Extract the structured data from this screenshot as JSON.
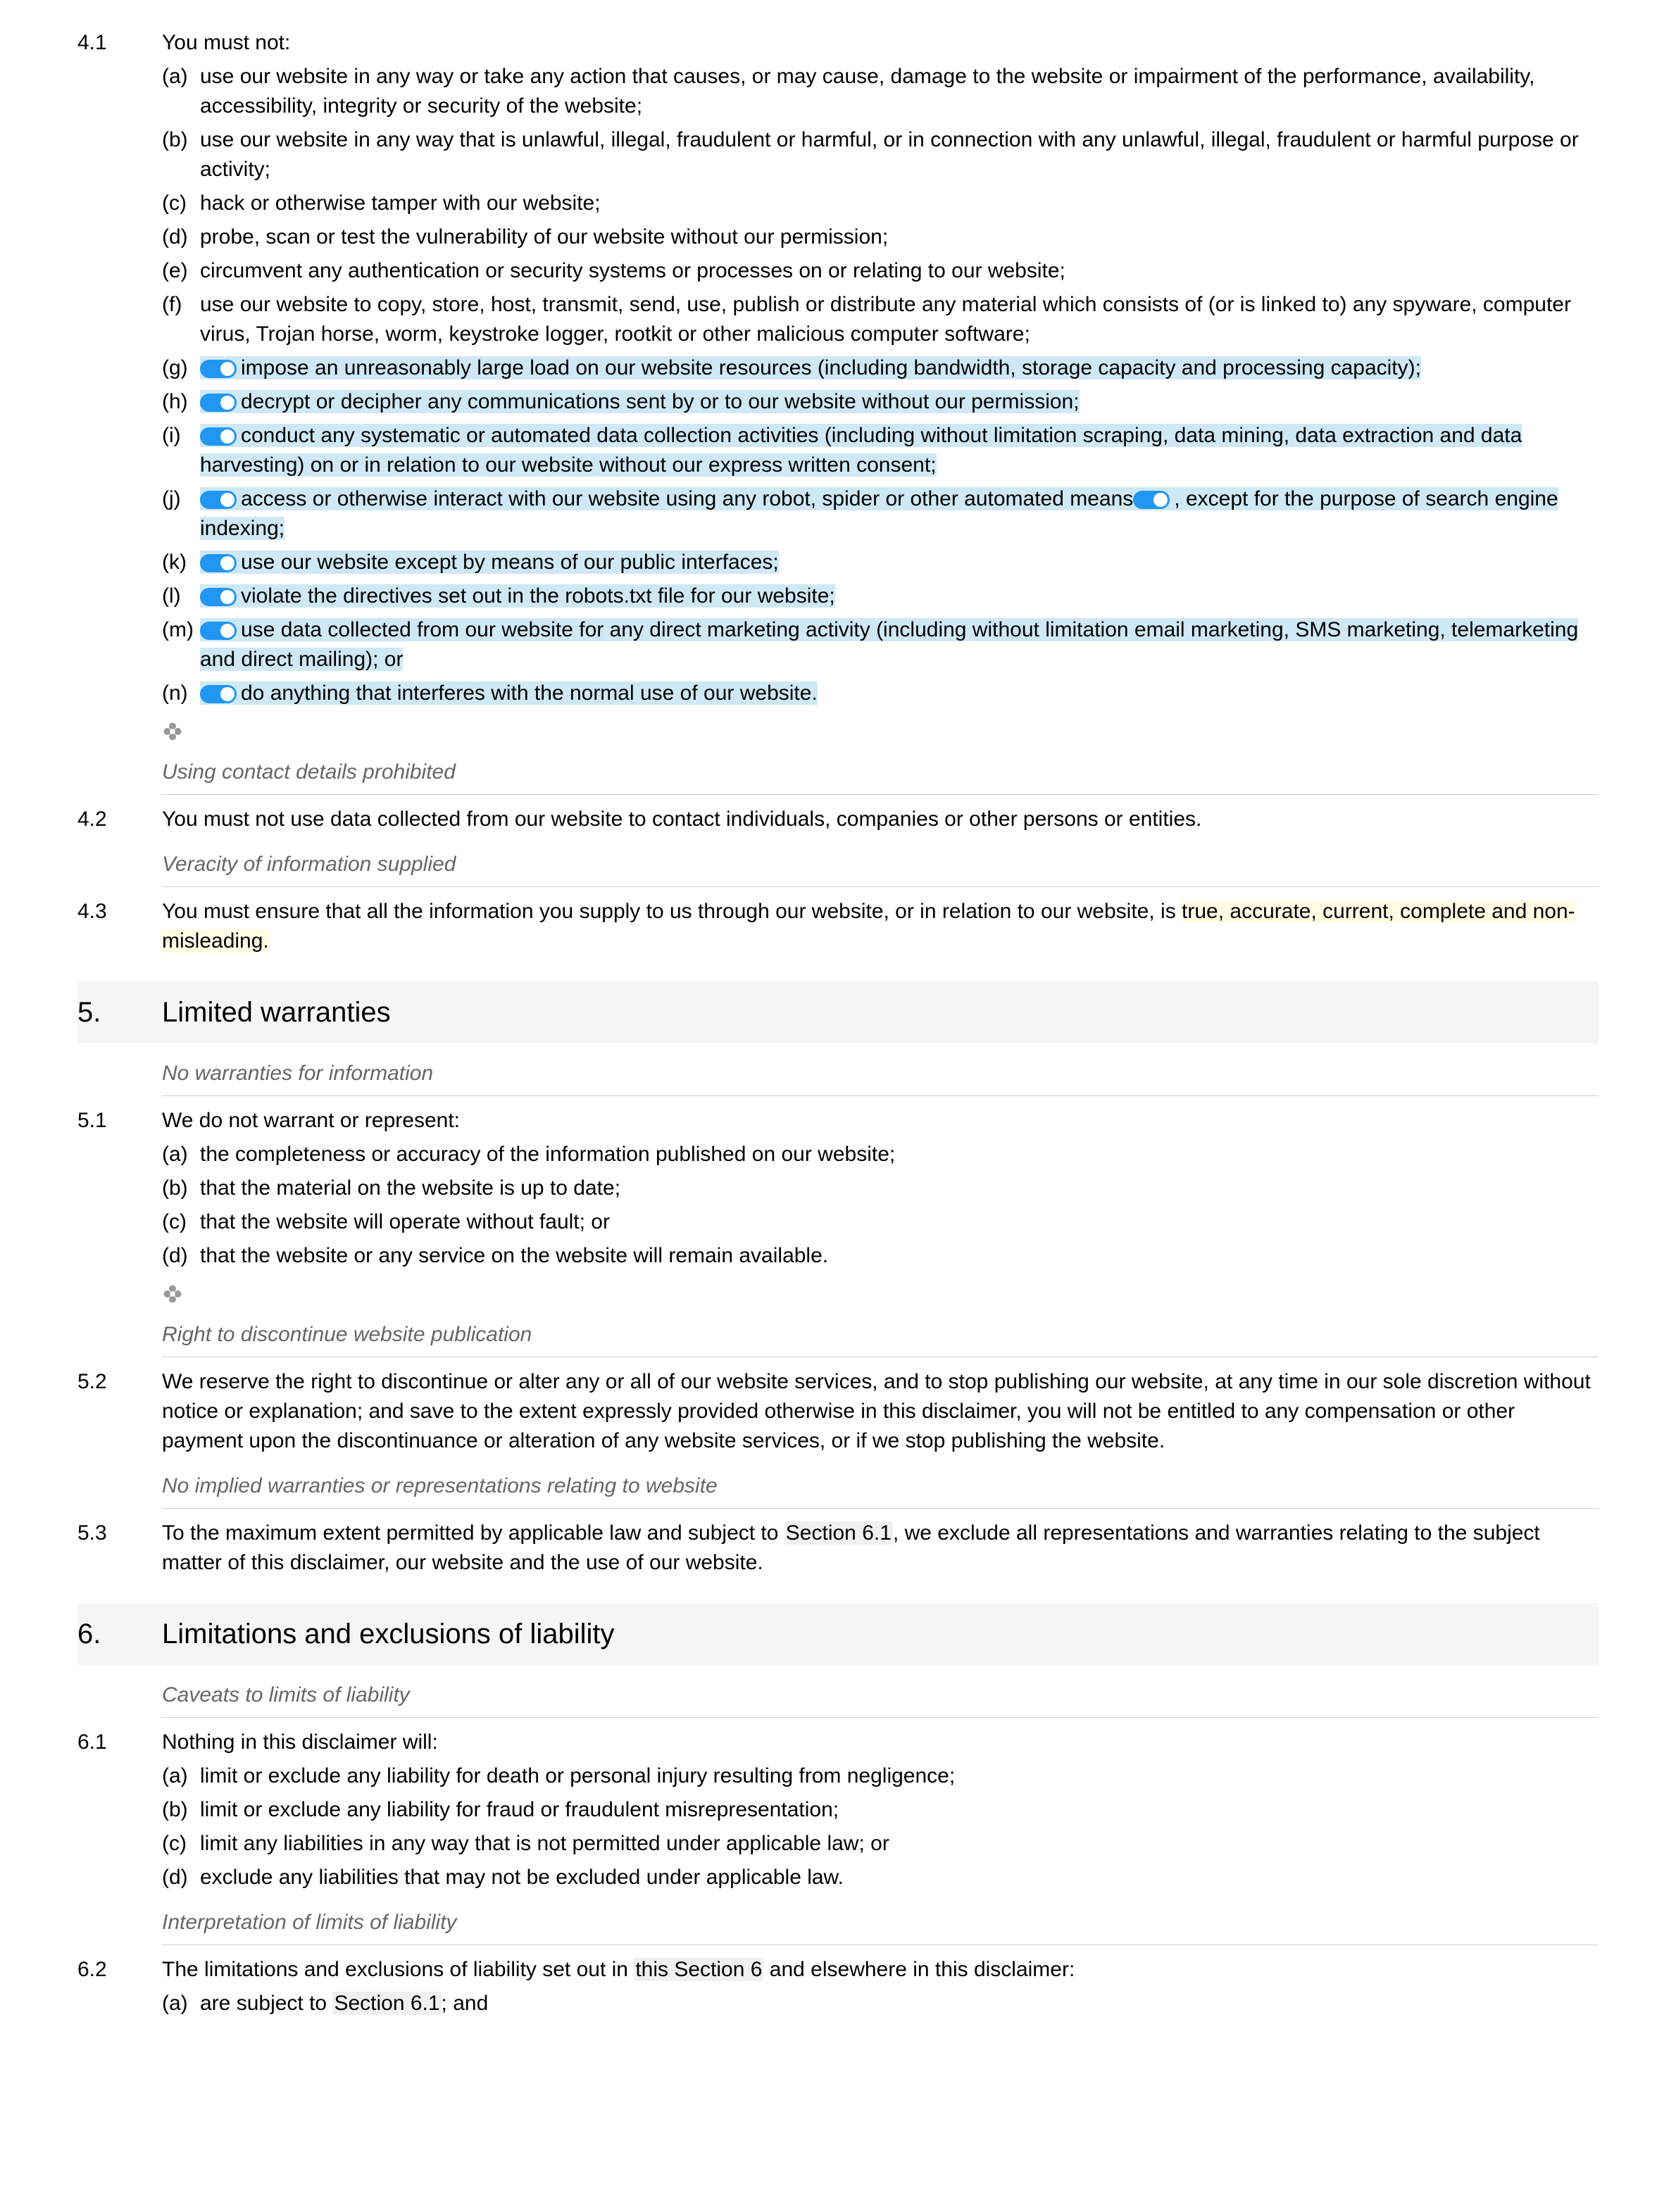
{
  "c41": {
    "num": "4.1",
    "lead": "You must not:",
    "a": {
      "l": "(a)",
      "t": "use our website in any way or take any action that causes, or may cause, damage to the website or impairment of the performance, availability, accessibility, integrity or security of the website;"
    },
    "b": {
      "l": "(b)",
      "t": "use our website in any way that is unlawful, illegal, fraudulent or harmful, or in connection with any unlawful, illegal, fraudulent or harmful purpose or activity;"
    },
    "c": {
      "l": "(c)",
      "t": "hack or otherwise tamper with our website;"
    },
    "d": {
      "l": "(d)",
      "t": "probe, scan or test the vulnerability of our website without our permission;"
    },
    "e": {
      "l": "(e)",
      "t": "circumvent any authentication or security systems or processes on or relating to our website;"
    },
    "f": {
      "l": "(f)",
      "t": "use our website to copy, store, host, transmit, send, use, publish or distribute any material which consists of (or is linked to) any spyware, computer virus, Trojan horse, worm, keystroke logger, rootkit or other malicious computer software;"
    },
    "g": {
      "l": "(g)",
      "t": "impose an unreasonably large load on our website resources (including bandwidth, storage capacity and processing capacity);"
    },
    "h": {
      "l": "(h)",
      "t": "decrypt or decipher any communications sent by or to our website without our permission;"
    },
    "i": {
      "l": "(i)",
      "t": "conduct any systematic or automated data collection activities (including without limitation scraping, data mining, data extraction and data harvesting) on or in relation to our website without our express written consent;"
    },
    "j": {
      "l": "(j)",
      "t1": "access or otherwise interact with our website using any robot, spider or other automated means",
      "t2": ", except for the purpose of search engine indexing;"
    },
    "k": {
      "l": "(k)",
      "t": "use our website except by means of our public interfaces;"
    },
    "l": {
      "l": "(l)",
      "t": "violate the directives set out in the robots.txt file for our website;"
    },
    "m": {
      "l": "(m)",
      "t": "use data collected from our website for any direct marketing activity (including without limitation email marketing, SMS marketing, telemarketing and direct mailing); or"
    },
    "n": {
      "l": "(n)",
      "t": "do anything that interferes with the normal use of our website."
    }
  },
  "note_contact": "Using contact details prohibited",
  "c42": {
    "num": "4.2",
    "t": "You must not use data collected from our website to contact individuals, companies or other persons or entities."
  },
  "note_veracity": "Veracity of information supplied",
  "c43": {
    "num": "4.3",
    "t1": "You must ensure that all the information you supply to us through our website, or in relation to our website, is ",
    "t2": "true, accurate, current, complete and non-misleading."
  },
  "s5": {
    "num": "5.",
    "title": "Limited warranties"
  },
  "note_nowarr": "No warranties for information",
  "c51": {
    "num": "5.1",
    "lead": "We do not warrant or represent:",
    "a": {
      "l": "(a)",
      "t": "the completeness or accuracy of the information published on our website;"
    },
    "b": {
      "l": "(b)",
      "t": "that the material on the website is up to date;"
    },
    "c": {
      "l": "(c)",
      "t": "that the website will operate without fault; or"
    },
    "d": {
      "l": "(d)",
      "t": "that the website or any service on the website will remain available."
    }
  },
  "note_discont": "Right to discontinue website publication",
  "c52": {
    "num": "5.2",
    "t": "We reserve the right to discontinue or alter any or all of our website services, and to stop publishing our website, at any time in our sole discretion without notice or explanation; and save to the extent expressly provided otherwise in this disclaimer, you will not be entitled to any compensation or other payment upon the discontinuance or alteration of any website services, or if we stop publishing the website."
  },
  "note_noimplied": "No implied warranties or representations relating to website",
  "c53": {
    "num": "5.3",
    "t1": "To the maximum extent permitted by applicable law and subject to ",
    "xref": "Section 6.1",
    "t2": ", we exclude all representations and warranties relating to the subject matter of this disclaimer, our website and the use of our website."
  },
  "s6": {
    "num": "6.",
    "title": "Limitations and exclusions of liability"
  },
  "note_caveats": "Caveats to limits of liability",
  "c61": {
    "num": "6.1",
    "lead": "Nothing in this disclaimer will:",
    "a": {
      "l": "(a)",
      "t": "limit or exclude any liability for death or personal injury resulting from negligence;"
    },
    "b": {
      "l": "(b)",
      "t": "limit or exclude any liability for fraud or fraudulent misrepresentation;"
    },
    "c": {
      "l": "(c)",
      "t": "limit any liabilities in any way that is not permitted under applicable law; or"
    },
    "d": {
      "l": "(d)",
      "t": "exclude any liabilities that may not be excluded under applicable law."
    }
  },
  "note_interp": "Interpretation of limits of liability",
  "c62": {
    "num": "6.2",
    "t1": "The limitations and exclusions of liability set out in ",
    "xref": "this Section 6",
    "t2": " and elsewhere in this disclaimer:",
    "a": {
      "l": "(a)",
      "t1": "are subject to ",
      "xref": "Section 6.1",
      "t2": "; and"
    }
  }
}
